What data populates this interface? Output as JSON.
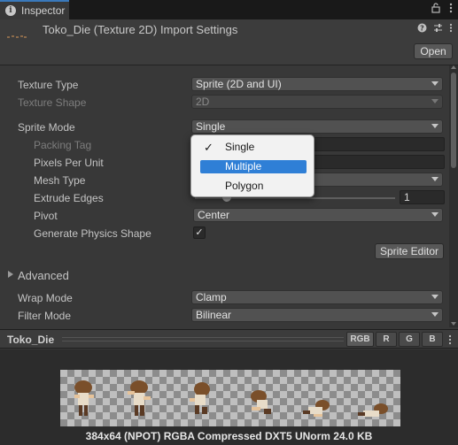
{
  "tab": {
    "label": "Inspector",
    "tools": [
      "lock-icon",
      "menu-icon"
    ]
  },
  "header": {
    "title": "Toko_Die (Texture 2D) Import Settings",
    "icons": [
      "help-icon",
      "settings-sliders-icon",
      "more-icon"
    ],
    "open_label": "Open"
  },
  "settings": {
    "texture_type": {
      "label": "Texture Type",
      "value": "Sprite (2D and UI)"
    },
    "texture_shape": {
      "label": "Texture Shape",
      "value": "2D"
    },
    "sprite_mode": {
      "label": "Sprite Mode",
      "value": "Single"
    },
    "packing_tag": {
      "label": "Packing Tag",
      "value": ""
    },
    "pixels_per_unit": {
      "label": "Pixels Per Unit",
      "value": ""
    },
    "mesh_type": {
      "label": "Mesh Type",
      "value": ""
    },
    "extrude_edges": {
      "label": "Extrude Edges",
      "value": "1"
    },
    "pivot": {
      "label": "Pivot",
      "value": "Center"
    },
    "generate_physics_shape": {
      "label": "Generate Physics Shape",
      "checked": true,
      "check_glyph": "✓"
    },
    "sprite_editor_label": "Sprite Editor",
    "advanced_label": "Advanced",
    "wrap_mode": {
      "label": "Wrap Mode",
      "value": "Clamp"
    },
    "filter_mode": {
      "label": "Filter Mode",
      "value": "Bilinear"
    }
  },
  "popup": {
    "items": [
      {
        "label": "Single",
        "checked": true,
        "check_glyph": "✓"
      },
      {
        "label": "Multiple",
        "highlighted": true
      },
      {
        "label": "Polygon"
      }
    ]
  },
  "preview": {
    "title": "Toko_Die",
    "channels": [
      "RGB",
      "R",
      "G",
      "B"
    ],
    "info": "384x64 (NPOT)  RGBA Compressed DXT5 UNorm   24.0 KB"
  },
  "colors": {
    "accent": "#3a79bb",
    "popup_highlight": "#2f7fd6"
  }
}
